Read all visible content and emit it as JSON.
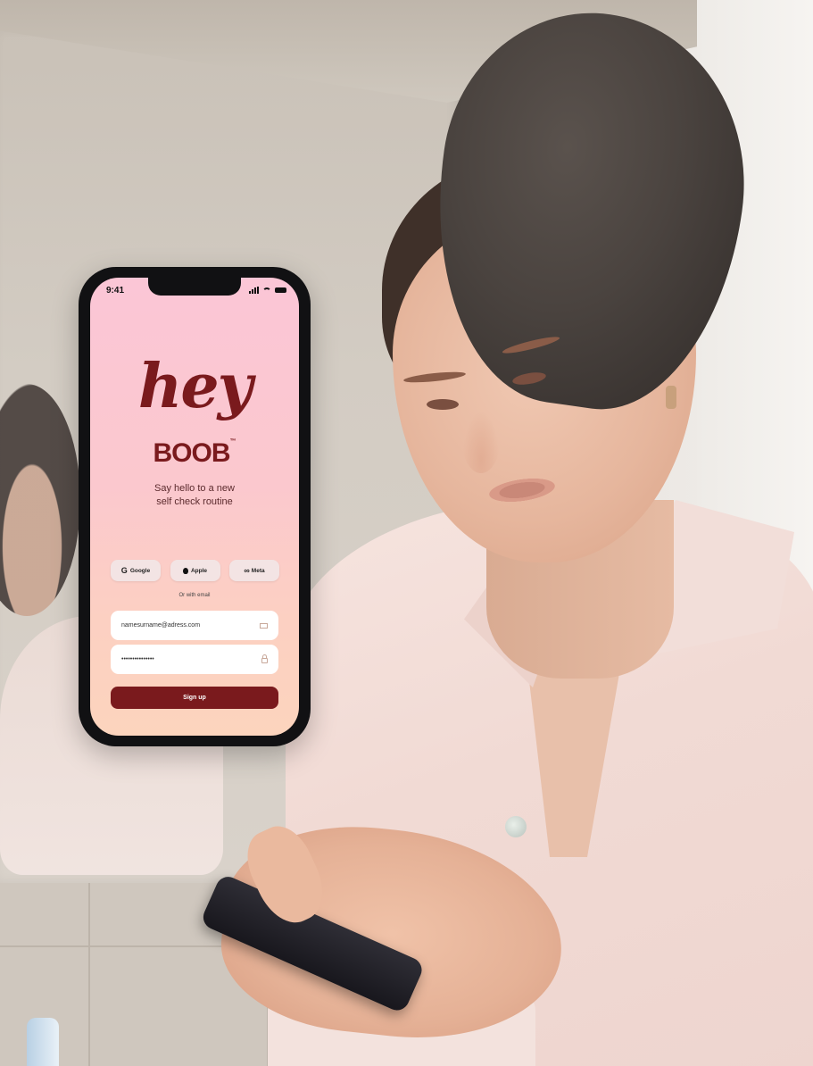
{
  "status_bar": {
    "time": "9:41"
  },
  "logo": {
    "line1": "hey",
    "line2": "BOOB",
    "trademark": "™"
  },
  "tagline": {
    "line1": "Say hello to a new",
    "line2": "self check routine"
  },
  "social_login": {
    "google": {
      "label": "Google",
      "icon": "google-icon"
    },
    "apple": {
      "label": "Apple",
      "icon": "apple-icon"
    },
    "meta": {
      "label": "Meta",
      "icon": "meta-icon"
    }
  },
  "divider": {
    "label": "Or with email"
  },
  "email_field": {
    "value": "namesurname@adress.com",
    "icon": "mail-icon"
  },
  "password_field": {
    "value": "•••••••••••••••",
    "icon": "lock-icon"
  },
  "signup_button": {
    "label": "Sign up"
  },
  "colors": {
    "brand": "#7a1a1d",
    "gradient_top": "#fbc6d6",
    "gradient_bottom": "#fcd4bd",
    "field_bg": "#ffffff",
    "social_bg": "#f3e4e4"
  }
}
